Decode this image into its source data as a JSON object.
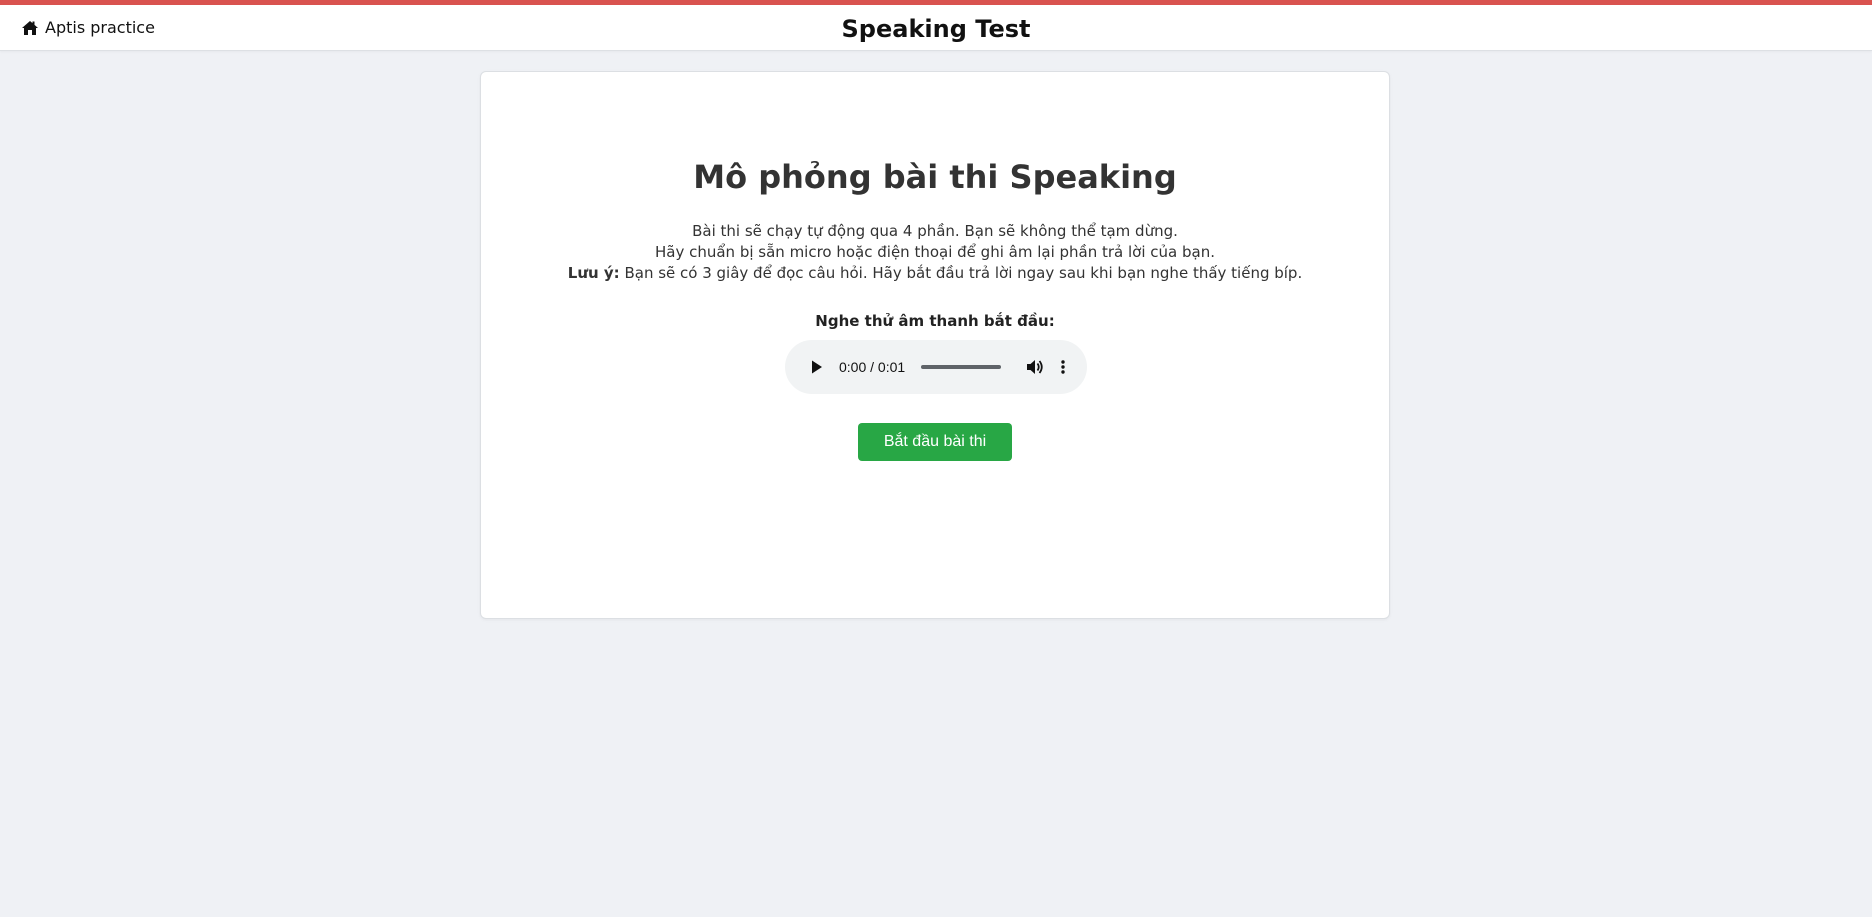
{
  "header": {
    "home_label": "Aptis practice",
    "home_icon": "home-icon",
    "title": "Speaking Test",
    "accent_color": "#d9534f"
  },
  "main": {
    "title": "Mô phỏng bài thi Speaking",
    "description_line1": "Bài thi sẽ chạy tự động qua 4 phần. Bạn sẽ không thể tạm dừng.",
    "description_line2": "Hãy chuẩn bị sẵn micro hoặc điện thoại để ghi âm lại phần trả lời của bạn.",
    "note_label": "Lưu ý:",
    "note_text": " Bạn sẽ có 3 giây để đọc câu hỏi. Hãy bắt đầu trả lời ngay sau khi bạn nghe thấy tiếng bíp.",
    "sound_test_label": "Nghe thử âm thanh bắt đầu:",
    "audio": {
      "time": "0:00 / 0:01",
      "progress": 0
    },
    "start_button_label": "Bắt đầu bài thi",
    "start_button_color": "#28a745"
  }
}
